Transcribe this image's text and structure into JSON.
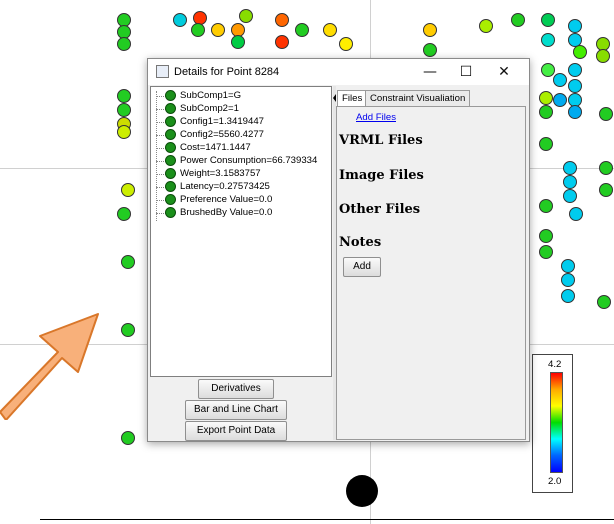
{
  "window": {
    "title": "Details for Point 8284",
    "controls": {
      "minimize": "—",
      "maximize": "☐",
      "close": "✕"
    }
  },
  "tree": {
    "items": [
      "SubComp1=G",
      "SubComp2=1",
      "Config1=1.3419447",
      "Config2=5560.4277",
      "Cost=1471.1447",
      "Power Consumption=66.739334",
      "Weight=3.1583757",
      "Latency=0.27573425",
      "Preference Value=0.0",
      "BrushedBy Value=0.0"
    ]
  },
  "buttons": {
    "derivatives": "Derivatives",
    "bar_line_chart": "Bar and Line Chart",
    "export": "Export Point Data",
    "add": "Add"
  },
  "tabs": [
    "Files",
    "Constraint Visualiation"
  ],
  "files_panel": {
    "add_files": "Add Files",
    "vrml": "VRML Files",
    "image": "Image Files",
    "other": "Other Files",
    "notes": "Notes"
  },
  "legend": {
    "max": "4.2",
    "min": "2.0",
    "colors": [
      "#ff0000",
      "#ffff00",
      "#00dd00",
      "#00ffff",
      "#0000ff"
    ]
  },
  "accent": {
    "arrow": "#f4a460",
    "highlight_dot": "#000000"
  }
}
